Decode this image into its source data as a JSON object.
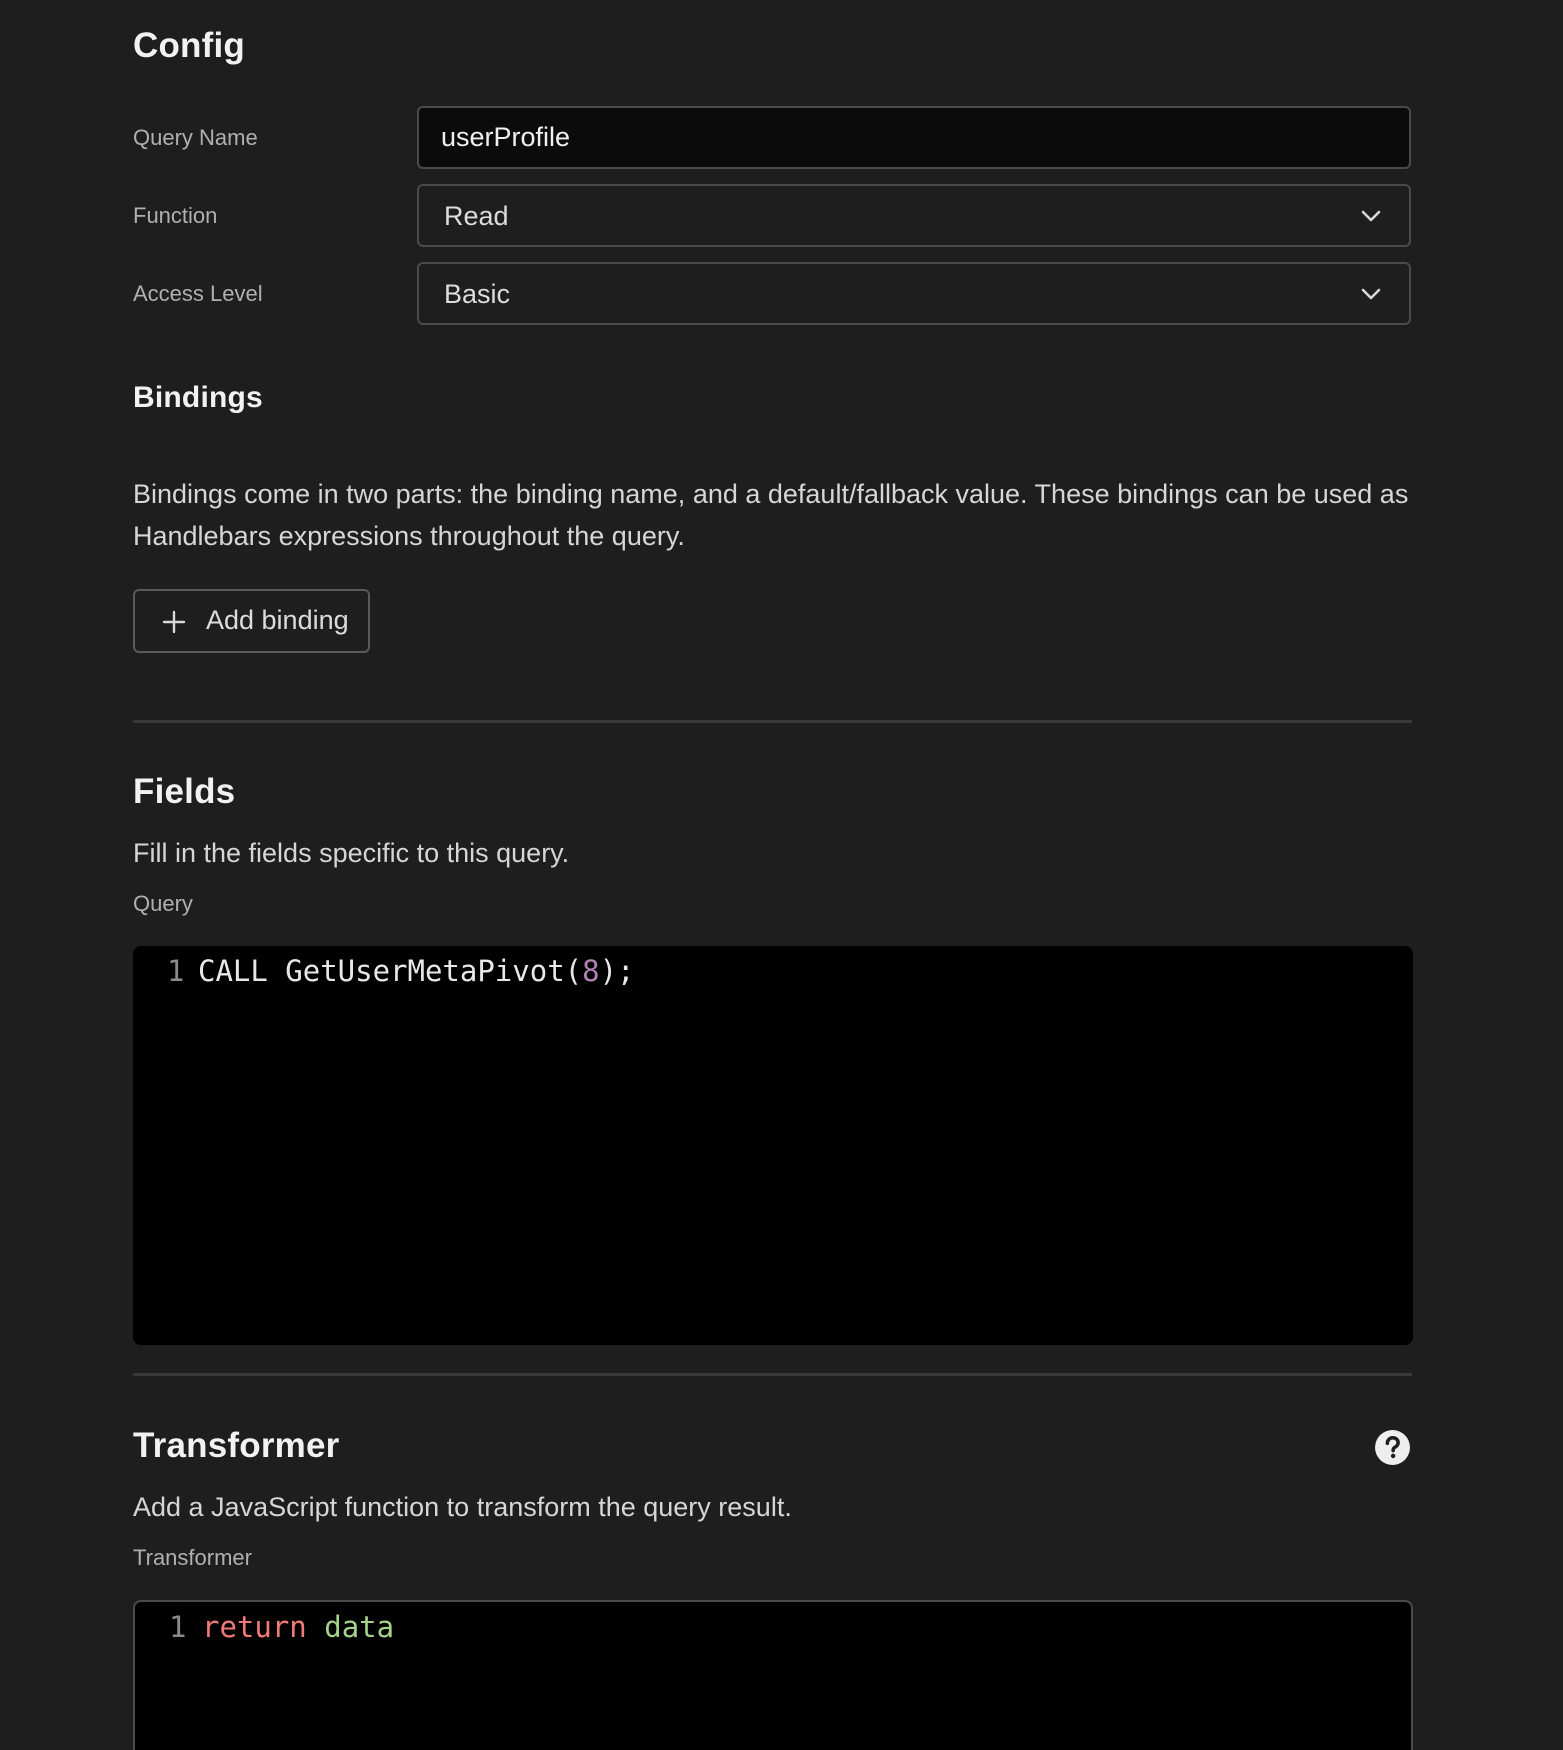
{
  "config": {
    "title": "Config",
    "query_name": {
      "label": "Query Name",
      "value": "userProfile"
    },
    "function": {
      "label": "Function",
      "value": "Read"
    },
    "access_level": {
      "label": "Access Level",
      "value": "Basic"
    }
  },
  "bindings": {
    "title": "Bindings",
    "description": "Bindings come in two parts: the binding name, and a default/fallback value. These bindings can be used as Handlebars expressions throughout the query.",
    "add_button_label": "Add binding"
  },
  "fields": {
    "title": "Fields",
    "description": "Fill in the fields specific to this query.",
    "query_label": "Query",
    "query_editor": {
      "line_number": "1",
      "code_part1": "CALL GetUserMetaPivot(",
      "code_number": "8",
      "code_part2": ");"
    }
  },
  "transformer": {
    "title": "Transformer",
    "description": "Add a JavaScript function to transform the query result.",
    "field_label": "Transformer",
    "editor": {
      "line_number": "1",
      "keyword": "return",
      "identifier": "data"
    },
    "help_icon": "question-circle-icon"
  },
  "colors": {
    "background": "#1e1e1e",
    "editor_background": "#000000",
    "number_token": "#b083b4",
    "keyword_token": "#f07a76",
    "identifier_token": "#a6d28a"
  }
}
